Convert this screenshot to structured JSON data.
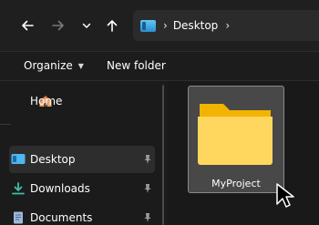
{
  "toolbar": {
    "back_icon": "arrow-left-icon",
    "forward_icon": "arrow-right-icon",
    "recent_icon": "chevron-down-icon",
    "up_icon": "arrow-up-icon"
  },
  "address_bar": {
    "breadcrumbs": [
      {
        "label": "Desktop"
      }
    ],
    "drive_icon": "desktop-icon"
  },
  "command_bar": {
    "organize_label": "Organize",
    "new_folder_label": "New folder"
  },
  "nav_pane": {
    "items": [
      {
        "label": "Home",
        "icon": "home-icon",
        "pinned": false
      },
      {
        "label": "Desktop",
        "icon": "desktop-icon",
        "pinned": true,
        "selected": true
      },
      {
        "label": "Downloads",
        "icon": "download-icon",
        "pinned": true
      },
      {
        "label": "Documents",
        "icon": "document-icon",
        "pinned": true
      }
    ]
  },
  "content": {
    "items": [
      {
        "label": "MyProject",
        "icon": "folder-icon",
        "selected": true
      }
    ]
  },
  "colors": {
    "window_bg": "#191919",
    "address_bg": "#2b2b2b",
    "selected_nav_bg": "#2d2d2d",
    "tile_bg": "#484848",
    "folder_yellow": "#ffd75e",
    "folder_back": "#f2b400"
  }
}
